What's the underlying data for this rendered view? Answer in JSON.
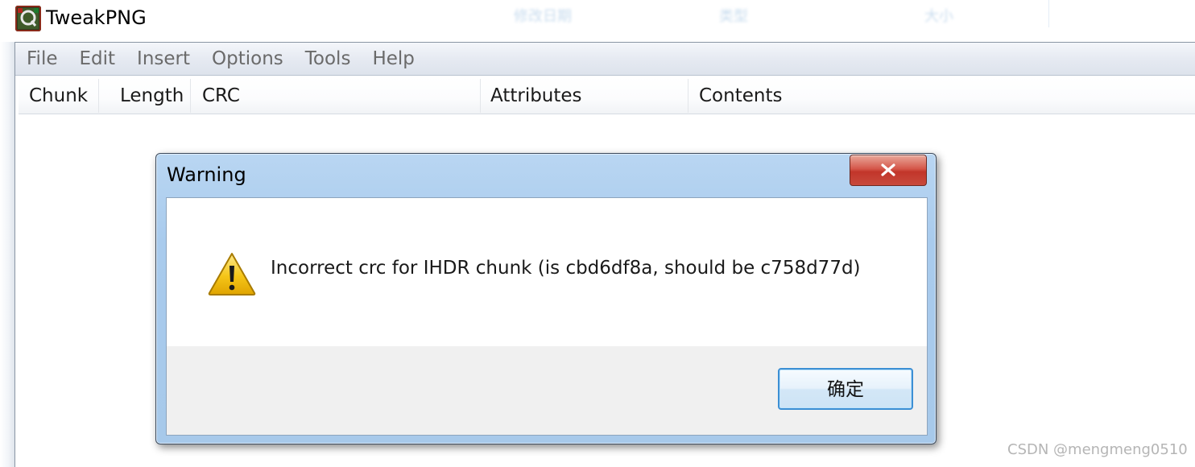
{
  "background_headers": [
    "修改日期",
    "类型",
    "大小"
  ],
  "app": {
    "title": "TweakPNG",
    "icon": "tweakpng-app-icon"
  },
  "menubar": {
    "items": [
      "File",
      "Edit",
      "Insert",
      "Options",
      "Tools",
      "Help"
    ]
  },
  "listview": {
    "columns": [
      "Chunk",
      "Length",
      "CRC",
      "Attributes",
      "Contents"
    ]
  },
  "dialog": {
    "title": "Warning",
    "close_icon": "close-icon",
    "warning_icon": "warning-icon",
    "message": "Incorrect crc for IHDR chunk (is cbd6df8a, should be c758d77d)",
    "ok_label": "确定"
  },
  "watermark": "CSDN @mengmeng0510",
  "colors": {
    "titlebar_glass": "#a9cbed",
    "close_button": "#c84a3c",
    "ok_button_border": "#3c8fd4",
    "warning_yellow": "#f5c518"
  }
}
